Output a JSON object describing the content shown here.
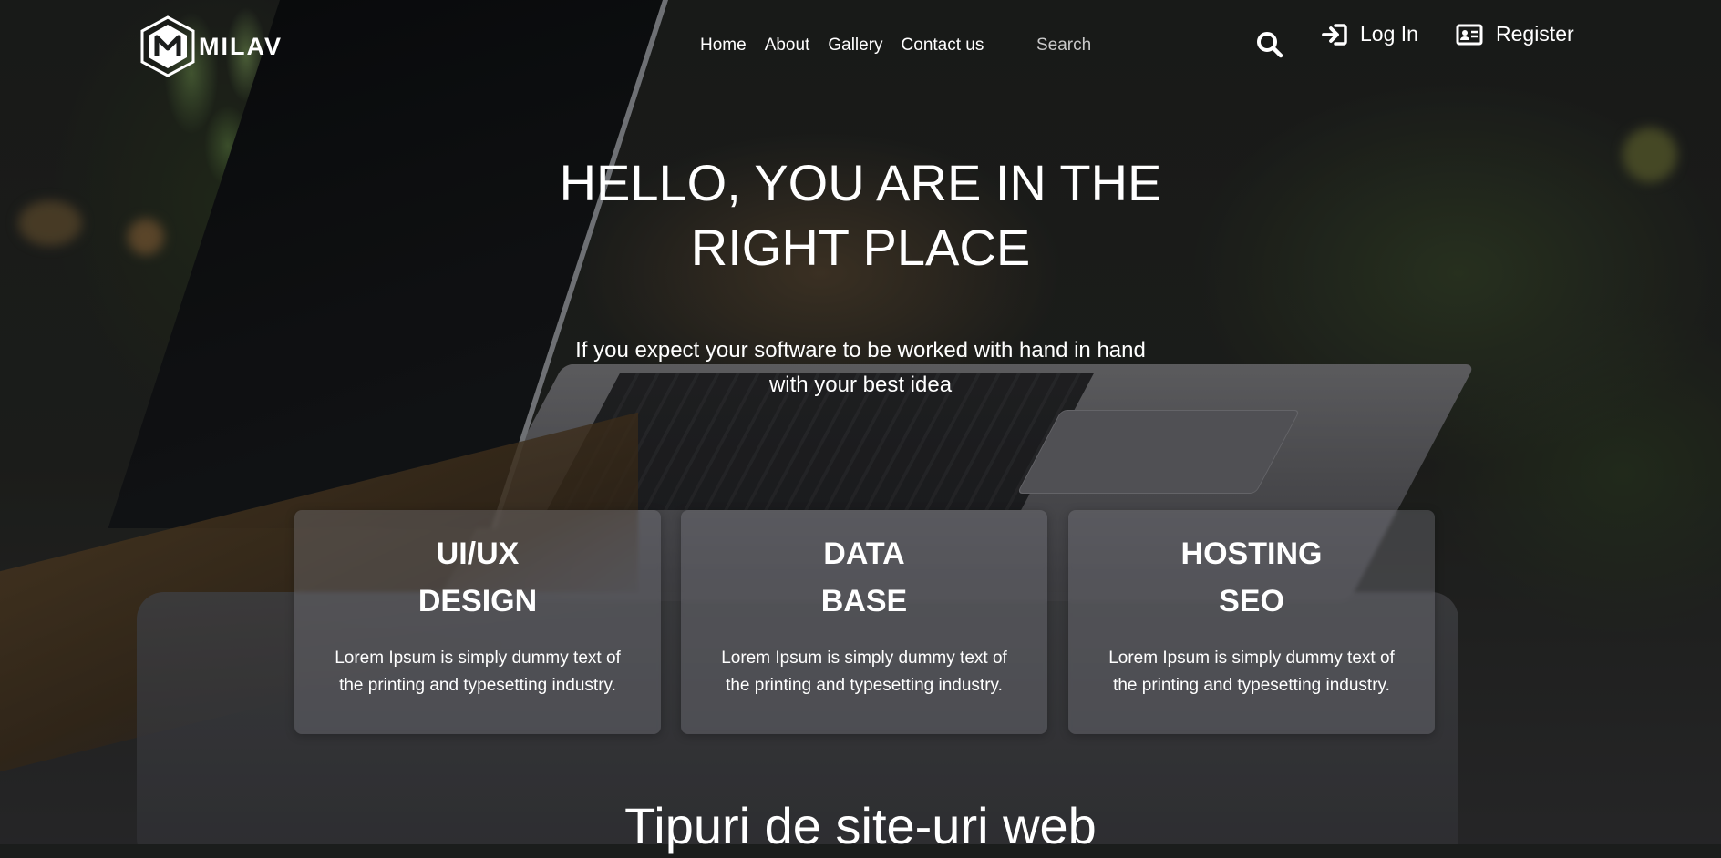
{
  "brand": {
    "name": "MILAV",
    "logo_letter": "M"
  },
  "nav": {
    "items": [
      {
        "label": "Home"
      },
      {
        "label": "About"
      },
      {
        "label": "Gallery"
      },
      {
        "label": "Contact us"
      }
    ]
  },
  "search": {
    "placeholder": "Search",
    "value": "",
    "icon": "search-icon"
  },
  "auth": {
    "login": {
      "label": "Log In",
      "icon": "sign-in-icon"
    },
    "register": {
      "label": "Register",
      "icon": "id-card-icon"
    }
  },
  "hero": {
    "title_line1": "HELLO, YOU ARE IN THE",
    "title_line2": "RIGHT PLACE",
    "subtitle_line1": "If you expect your software to be worked with hand in hand",
    "subtitle_line2": "with your best idea"
  },
  "cards": [
    {
      "line1": "UI/UX",
      "line2": "DESIGN",
      "text_line1": "Lorem Ipsum is simply dummy text of",
      "text_line2": "the printing and typesetting industry."
    },
    {
      "line1": "DATA",
      "line2": "BASE",
      "text_line1": "Lorem Ipsum is simply dummy text of",
      "text_line2": "the printing and typesetting industry."
    },
    {
      "line1": "HOSTING",
      "line2": "SEO",
      "text_line1": "Lorem Ipsum is simply dummy text of",
      "text_line2": "the printing and typesetting industry."
    }
  ],
  "section": {
    "title": "Tipuri de site-uri web"
  },
  "colors": {
    "text": "#ffffff",
    "card_bg": "rgba(130,130,138,0.35)",
    "overlay": "rgba(0,0,0,0.35)"
  }
}
